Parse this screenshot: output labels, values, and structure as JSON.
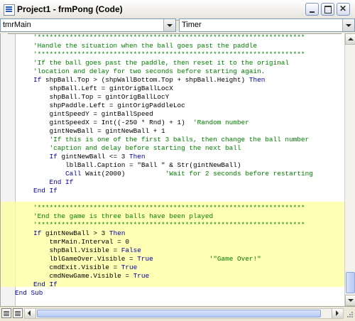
{
  "window": {
    "title": "Project1 - frmPong (Code)"
  },
  "object_combo": {
    "value": "tmrMain"
  },
  "procedure_combo": {
    "value": "Timer"
  },
  "code": {
    "lines": [
      [
        [
          "cm",
          "'Handle the situation when the ball goes past the paddle"
        ]
      ],
      [
        [
          "cm",
          "'*******************************************************************"
        ]
      ],
      [
        [
          "cm",
          "'If the ball goes past the paddle, then reset it to the original"
        ]
      ],
      [
        [
          "cm",
          "'location and delay for two seconds before starting again."
        ]
      ],
      [
        [
          "kw",
          "If "
        ],
        [
          "tx",
          "shpBall.Top > (shpWallBottom.Top + shpBall.Height) "
        ],
        [
          "kw",
          "Then"
        ]
      ],
      [
        [
          "tx",
          "    shpBall.Left = gintOrigBallLocX"
        ]
      ],
      [
        [
          "tx",
          "    shpBall.Top = gintOrigBallLocY"
        ]
      ],
      [
        [
          "tx",
          "    shpPaddle.Left = gintOrigPaddleLoc"
        ]
      ],
      [
        [
          "tx",
          "    gintSpeedY = gintBallSpeed"
        ]
      ],
      [
        [
          "tx",
          "    gintSpeedX = Int((-250 * Rnd) + 1)  "
        ],
        [
          "cm",
          "'Random number"
        ]
      ],
      [
        [
          "tx",
          "    gintNewBall = gintNewBall + 1"
        ]
      ],
      [
        [
          "cm",
          "    'If this is one of the first 3 balls, then change the ball number"
        ]
      ],
      [
        [
          "cm",
          "    'caption and delay before starting the next ball"
        ]
      ],
      [
        [
          "kw",
          "    If "
        ],
        [
          "tx",
          "gintNewBall <= 3 "
        ],
        [
          "kw",
          "Then"
        ]
      ],
      [
        [
          "tx",
          "        lblBall.Caption = \"Ball \" & Str(gintNewBall)"
        ]
      ],
      [
        [
          "kw",
          "        Call "
        ],
        [
          "tx",
          "Wait(2000)          "
        ],
        [
          "cm",
          "'Wait for 2 seconds before restarting"
        ]
      ],
      [
        [
          "kw",
          "    End If"
        ]
      ],
      [
        [
          "kw",
          "End If"
        ]
      ],
      [
        [
          "tx",
          ""
        ]
      ],
      [
        [
          "cm",
          "'*******************************************************************"
        ]
      ],
      [
        [
          "cm",
          "'End the game is three balls have been played"
        ]
      ],
      [
        [
          "cm",
          "'*******************************************************************"
        ]
      ],
      [
        [
          "kw",
          "If "
        ],
        [
          "tx",
          "gintNewBall > 3 "
        ],
        [
          "kw",
          "Then"
        ]
      ],
      [
        [
          "tx",
          "    tmrMain.Interval = 0"
        ]
      ],
      [
        [
          "tx",
          "    shpBall.Visible = "
        ],
        [
          "kw",
          "False"
        ]
      ],
      [
        [
          "tx",
          "    lblGameOver.Visible = "
        ],
        [
          "kw",
          "True"
        ],
        [
          "tx",
          "              "
        ],
        [
          "cm",
          "'\"Game Over!\""
        ]
      ],
      [
        [
          "tx",
          "    cmdExit.Visible = "
        ],
        [
          "kw",
          "True"
        ]
      ],
      [
        [
          "tx",
          "    cmdNewGame.Visible = "
        ],
        [
          "kw",
          "True"
        ]
      ],
      [
        [
          "kw",
          "End If"
        ]
      ],
      [
        [
          "kw",
          "End Sub"
        ]
      ]
    ],
    "indent_levels": [
      1,
      1,
      1,
      1,
      1,
      1,
      1,
      1,
      1,
      1,
      1,
      1,
      1,
      1,
      1,
      1,
      1,
      1,
      1,
      1,
      1,
      1,
      1,
      1,
      1,
      1,
      1,
      1,
      1,
      0
    ]
  },
  "colors": {
    "keyword": "#0000a0",
    "comment": "#008000",
    "text": "#000000",
    "highlight": "#ffff9e"
  },
  "icons": [
    "app-icon",
    "minimize-icon",
    "maximize-icon",
    "close-icon",
    "dropdown-arrow-icon",
    "procedure-view-icon",
    "full-module-view-icon"
  ]
}
